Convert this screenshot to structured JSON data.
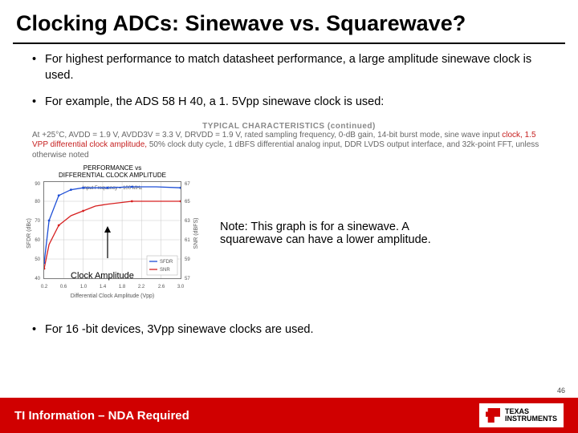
{
  "title": "Clocking ADCs: Sinewave vs. Squarewave?",
  "bullets": {
    "b1": "For highest performance to match datasheet performance, a large amplitude sinewave clock is used.",
    "b2": "For example, the ADS 58 H 40, a 1. 5Vpp sinewave clock is used:",
    "b3": "For 16 -bit devices, 3Vpp sinewave clocks are used."
  },
  "typchar": {
    "header": "TYPICAL CHARACTERISTICS (continued)",
    "line1_pre": "At +25°C, AVDD = 1.9 V, AVDD3V = 3.3 V, DRVDD = 1.9 V, rated sampling frequency, 0-dB gain, 14-bit burst mode, sine wave input ",
    "line1_hl": "clock, 1.5 VPP differential clock amplitude,",
    "line1_post": " 50% clock duty cycle,  1 dBFS differential analog input, DDR LVDS output interface, and 32k-point FFT, unless otherwise noted"
  },
  "chart_caption": "PERFORMANCE vs\nDIFFERENTIAL CLOCK AMPLITUDE",
  "chart_subcap": "Input Frequency = 100 MHz",
  "arrow_label": "Clock Amplitude",
  "note": "Note: This graph is for a sinewave. A squarewave can have a lower amplitude.",
  "footer": "TI Information – NDA Required",
  "logo_line1": "TEXAS",
  "logo_line2": "INSTRUMENTS",
  "page_num": "46",
  "chart_data": {
    "type": "line",
    "title": "PERFORMANCE vs DIFFERENTIAL CLOCK AMPLITUDE",
    "xlabel": "Differential Clock Amplitude (Vpp)",
    "ylabel_left": "SFDR (dBc)",
    "ylabel_right": "SNR (dBFS)",
    "xlim": [
      0.2,
      3.0
    ],
    "ylim_left": [
      40,
      90
    ],
    "ylim_right": [
      57,
      67
    ],
    "x": [
      0.2,
      0.3,
      0.5,
      0.75,
      1.0,
      1.25,
      1.5,
      2.0,
      2.5,
      3.0
    ],
    "series": [
      {
        "name": "SFDR",
        "axis": "left",
        "color": "#1e4fd6",
        "values": [
          48,
          70,
          83,
          86,
          87,
          87,
          87,
          87.5,
          87.5,
          87
        ]
      },
      {
        "name": "SNR",
        "axis": "right",
        "color": "#d62020",
        "values": [
          58,
          60.5,
          62.5,
          63.5,
          64,
          64.5,
          64.7,
          65,
          65,
          65
        ]
      }
    ],
    "legend_position": "lower-right",
    "grid": true
  }
}
